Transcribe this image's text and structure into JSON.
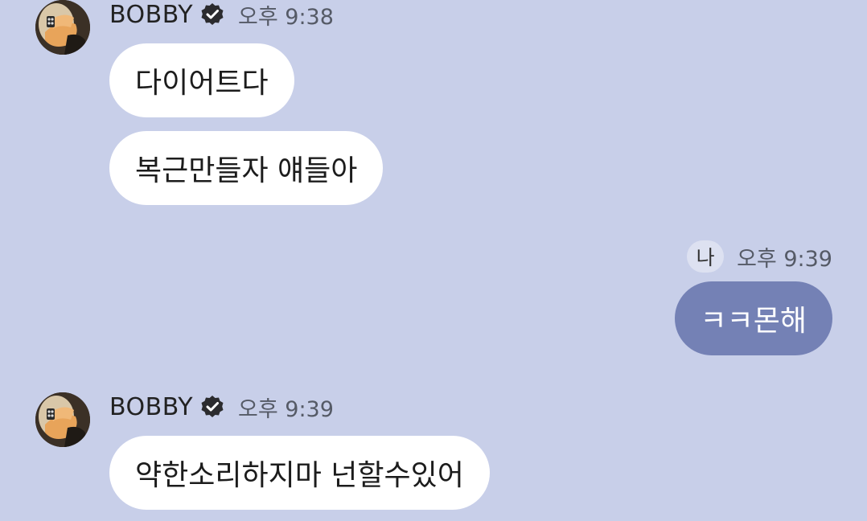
{
  "messages": [
    {
      "type": "incoming",
      "sender": "BOBBY",
      "time": "오후 9:38",
      "bubbles": [
        "다이어트다",
        "복근만들자 얘들아"
      ]
    },
    {
      "type": "outgoing",
      "me_label": "나",
      "time": "오후 9:39",
      "bubbles": [
        "ㅋㅋ몬해"
      ]
    },
    {
      "type": "incoming",
      "sender": "BOBBY",
      "time": "오후 9:39",
      "bubbles": [
        "약한소리하지마 넌할수있어"
      ]
    }
  ],
  "colors": {
    "background": "#c8cfe9",
    "incoming_bubble": "#ffffff",
    "outgoing_bubble": "#7481b5",
    "me_badge": "#dde1f1"
  },
  "icons": {
    "verified": "verified-badge-icon",
    "avatar": "profile-photo"
  }
}
